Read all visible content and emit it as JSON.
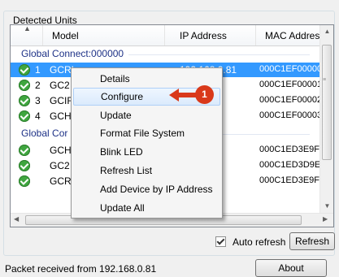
{
  "group_title": "Detected Units",
  "columns": {
    "model": "Model",
    "ip": "IP Address",
    "mac": "MAC Address"
  },
  "groups": [
    {
      "title": "Global Connect:000000",
      "rows": [
        {
          "idx": "1",
          "model": "GCRI",
          "ip": "192.168.0.81",
          "mac": "000C1EF00000",
          "selected": true
        },
        {
          "idx": "2",
          "model": "GC2",
          "ip": "",
          "mac": "000C1EF00001"
        },
        {
          "idx": "3",
          "model": "GCIF",
          "ip": "",
          "mac": "000C1EF00002"
        },
        {
          "idx": "4",
          "model": "GCH",
          "ip": "",
          "mac": "000C1EF00003"
        }
      ]
    },
    {
      "title": "Global Cor",
      "rows": [
        {
          "idx": "",
          "model": "GCH",
          "ip": "",
          "mac": "000C1ED3E9F6"
        },
        {
          "idx": "",
          "model": "GC2",
          "ip": "",
          "mac": "000C1ED3D9E7"
        },
        {
          "idx": "",
          "model": "GCR",
          "ip": "",
          "mac": "000C1ED3E9FD"
        }
      ]
    }
  ],
  "context_menu": {
    "items": [
      "Details",
      "Configure",
      "Update",
      "Format File System",
      "Blink LED",
      "Refresh List",
      "Add Device by IP Address",
      "Update All"
    ],
    "highlighted": "Configure"
  },
  "callout_number": "1",
  "auto_refresh": {
    "label": "Auto refresh",
    "checked": true
  },
  "refresh_button": "Refresh",
  "about_button": "About",
  "status_text": "Packet received from 192.168.0.81",
  "colors": {
    "selection": "#3399ff",
    "group_header": "#1e3287",
    "callout": "#d9391a",
    "status_ok": "#3fa63f"
  }
}
